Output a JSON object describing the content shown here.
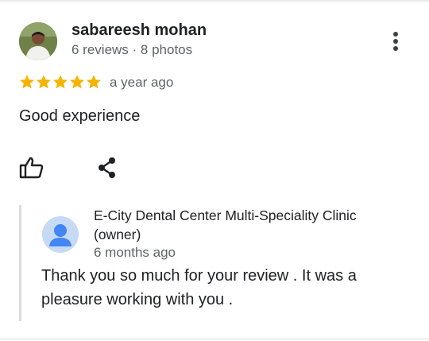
{
  "review": {
    "author": "sabareesh mohan",
    "meta": "6 reviews · 8 photos",
    "rating": 5,
    "rating_max": 5,
    "time": "a year ago",
    "text": "Good experience"
  },
  "actions": {
    "like_icon": "thumbs-up-icon",
    "share_icon": "share-icon",
    "more_icon": "more-vert-icon"
  },
  "owner_reply": {
    "name": "E-City Dental Center Multi-Speciality Clinic (owner)",
    "time": "6 months ago",
    "text": "Thank you so much for your review . It was a pleasure working with you ."
  },
  "colors": {
    "star": "#F4B400",
    "owner_avatar_bg": "#C6D9F5",
    "owner_avatar_fg": "#4285F4",
    "muted": "#5F6368"
  }
}
